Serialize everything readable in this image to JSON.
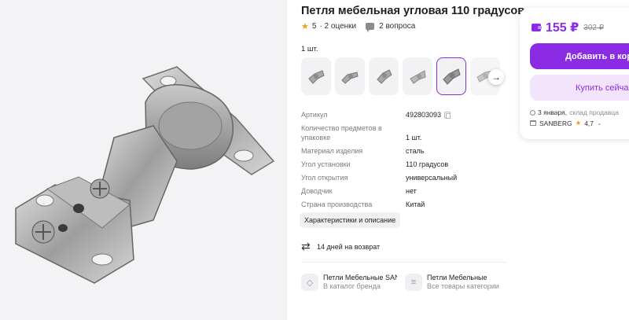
{
  "product": {
    "title": "Петля мебельная угловая 110 градусов",
    "rating": "5",
    "ratings_count": "· 2 оценки",
    "questions": "2 вопроса",
    "quantity_label": "1 шт."
  },
  "thumbnails": [
    {
      "icon": "hinge-thumbnail",
      "selected": false
    },
    {
      "icon": "hinge-thumbnail",
      "selected": false
    },
    {
      "icon": "hinge-thumbnail",
      "selected": false
    },
    {
      "icon": "hinge-thumbnail",
      "selected": false
    },
    {
      "icon": "hinge-thumbnail",
      "selected": true
    },
    {
      "icon": "hinge-thumbnail",
      "selected": false
    }
  ],
  "specs": [
    {
      "key": "Артикул",
      "value": "492803093"
    },
    {
      "key": "Количество предметов в упаковке",
      "value": "1 шт."
    },
    {
      "key": "Материал изделия",
      "value": "сталь"
    },
    {
      "key": "Угол установки",
      "value": "110 градусов"
    },
    {
      "key": "Угол открытия",
      "value": "универсальный"
    },
    {
      "key": "Доводчик",
      "value": "нет"
    },
    {
      "key": "Страна производства",
      "value": "Китай"
    }
  ],
  "characteristics_button": "Характеристики и описание",
  "return_policy": "14 дней на возврат",
  "brand_links": {
    "brand": {
      "title": "Петли Мебельные SAN",
      "subtitle": "В каталог бренда"
    },
    "category": {
      "title": "Петли Мебельные",
      "subtitle": "Все товары категории"
    }
  },
  "buy_box": {
    "price": "155 ₽",
    "old_price": "302 ₽",
    "add_to_cart": "Добавить в кор",
    "buy_now": "Купить сейча",
    "delivery_date": "3 января,",
    "delivery_source": "склад продавца",
    "seller_name": "SANBERG",
    "seller_rating": "4,7"
  },
  "colors": {
    "accent": "#8b2ce4",
    "accent_light": "#f3e4fd",
    "star": "#f59a23"
  }
}
